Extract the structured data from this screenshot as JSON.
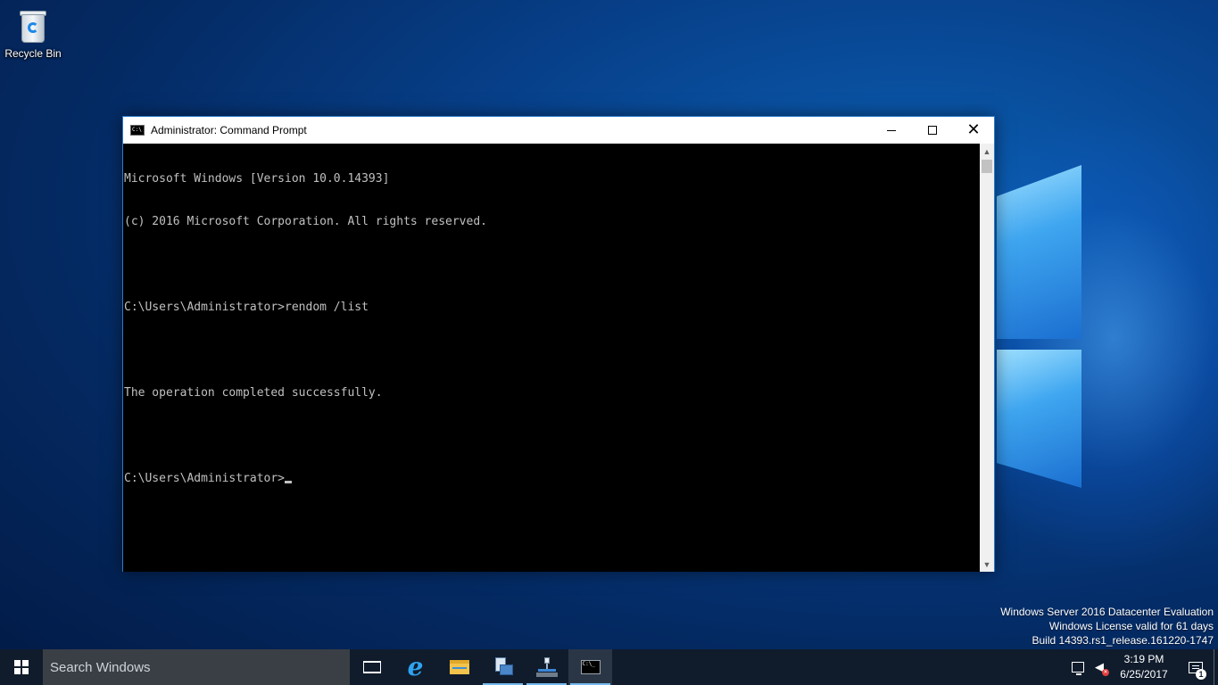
{
  "desktop": {
    "recycle_bin_label": "Recycle Bin"
  },
  "window": {
    "title": "Administrator: Command Prompt",
    "icon_text": "C:\\",
    "controls": {
      "minimize": "minimize-icon",
      "maximize": "maximize-icon",
      "close": "✕"
    }
  },
  "console": {
    "lines": [
      "Microsoft Windows [Version 10.0.14393]",
      "(c) 2016 Microsoft Corporation. All rights reserved.",
      "",
      "C:\\Users\\Administrator>rendom /list",
      "",
      "The operation completed successfully.",
      "",
      "C:\\Users\\Administrator>"
    ],
    "text_color": "#c0c0c0",
    "background": "#000000"
  },
  "watermark": {
    "line1": "Windows Server 2016 Datacenter Evaluation",
    "line2": "Windows License valid for 61 days",
    "line3": "Build 14393.rs1_release.161220-1747"
  },
  "taskbar": {
    "search_placeholder": "Search Windows",
    "cmd_icon_text": "C:\\_",
    "pinned": [
      "task-view-icon",
      "internet-explorer-icon",
      "file-explorer-icon",
      "server-manager-icon",
      "network-icon",
      "command-prompt-icon"
    ],
    "clock_time": "3:19 PM",
    "clock_date": "6/25/2017",
    "notification_count": "1",
    "accent_color": "#76b9ed"
  }
}
